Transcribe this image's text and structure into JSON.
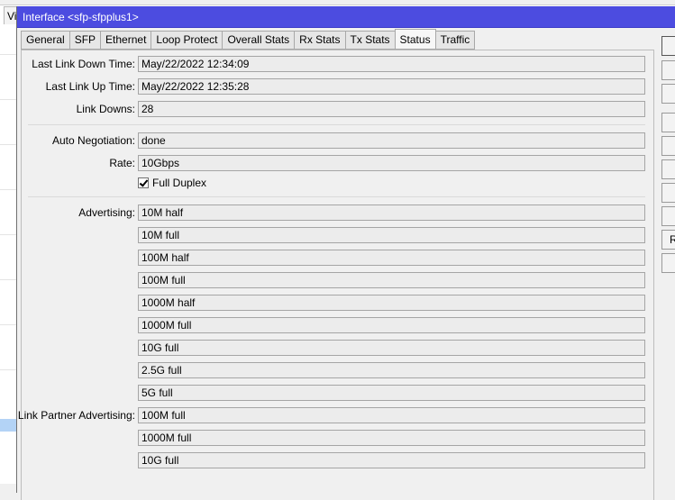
{
  "background": {
    "tab_label": "Vi"
  },
  "dialog": {
    "title": "Interface <sfp-sfpplus1>",
    "tabs": [
      {
        "label": "General"
      },
      {
        "label": "SFP"
      },
      {
        "label": "Ethernet"
      },
      {
        "label": "Loop Protect"
      },
      {
        "label": "Overall Stats"
      },
      {
        "label": "Rx Stats"
      },
      {
        "label": "Tx Stats"
      },
      {
        "label": "Status",
        "active": true
      },
      {
        "label": "Traffic"
      }
    ],
    "status": {
      "last_link_down_time": {
        "label": "Last Link Down Time:",
        "value": "May/22/2022 12:34:09"
      },
      "last_link_up_time": {
        "label": "Last Link Up Time:",
        "value": "May/22/2022 12:35:28"
      },
      "link_downs": {
        "label": "Link Downs:",
        "value": "28"
      },
      "auto_negotiation": {
        "label": "Auto Negotiation:",
        "value": "done"
      },
      "rate": {
        "label": "Rate:",
        "value": "10Gbps"
      },
      "full_duplex": {
        "label": "Full Duplex",
        "checked": true
      },
      "advertising": {
        "label": "Advertising:",
        "values": [
          "10M half",
          "10M full",
          "100M half",
          "100M full",
          "1000M half",
          "1000M full",
          "10G full",
          "2.5G full",
          "5G full"
        ]
      },
      "link_partner_advertising": {
        "label": "Link Partner Advertising:",
        "values": [
          "100M full",
          "1000M full",
          "10G full"
        ]
      }
    },
    "side_buttons": [
      {
        "label": ""
      },
      {
        "label": ""
      },
      {
        "label": ""
      },
      {
        "label": ""
      },
      {
        "label": ""
      },
      {
        "label": ""
      },
      {
        "label": ""
      },
      {
        "label": ""
      },
      {
        "label": "R"
      },
      {
        "label": ""
      }
    ]
  }
}
